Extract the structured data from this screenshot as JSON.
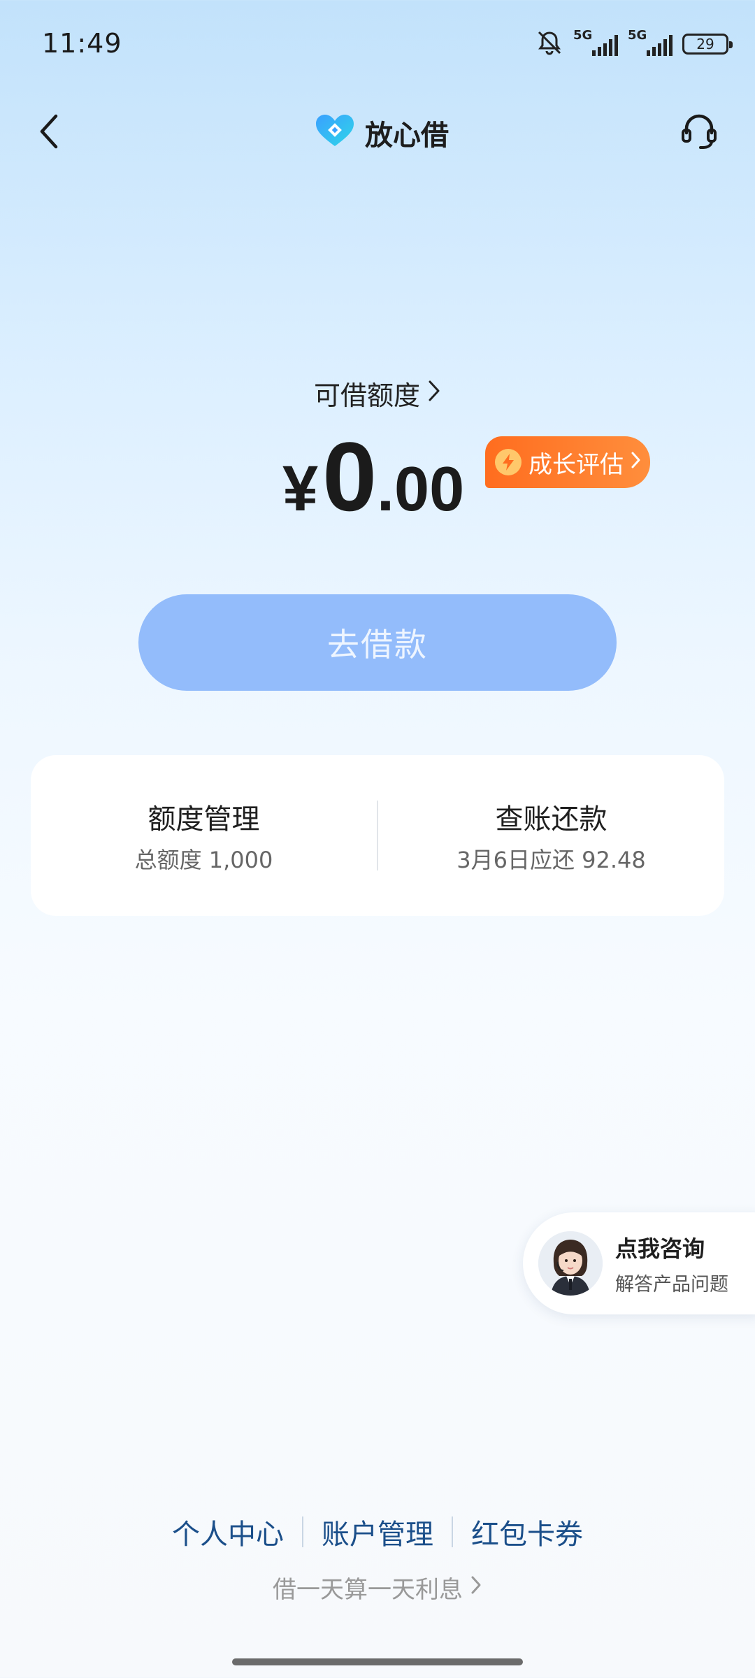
{
  "status_bar": {
    "time": "11:49",
    "network_1": "5G",
    "network_2": "5G",
    "battery": "29"
  },
  "header": {
    "title": "放心借"
  },
  "credit": {
    "label": "可借额度",
    "currency": "¥",
    "amount_integer": "0",
    "amount_decimal": ".00",
    "growth_badge_label": "成长评估"
  },
  "borrow_button_label": "去借款",
  "cards": {
    "limit": {
      "title": "额度管理",
      "subtitle": "总额度 1,000"
    },
    "bill": {
      "title": "查账还款",
      "subtitle": "3月6日应还 92.48"
    }
  },
  "consult": {
    "title": "点我咨询",
    "subtitle": "解答产品问题"
  },
  "footer": {
    "links": [
      "个人中心",
      "账户管理",
      "红包卡券"
    ],
    "interest_text": "借一天算一天利息"
  },
  "colors": {
    "primary_button": "#93bcfb",
    "badge_orange": "#ff6d1f",
    "link_blue": "#1b4f8a"
  },
  "icons": [
    "mute-bell-icon",
    "back-arrow-icon",
    "app-logo-icon",
    "customer-service-icon",
    "chevron-right-icon",
    "lightning-icon"
  ]
}
